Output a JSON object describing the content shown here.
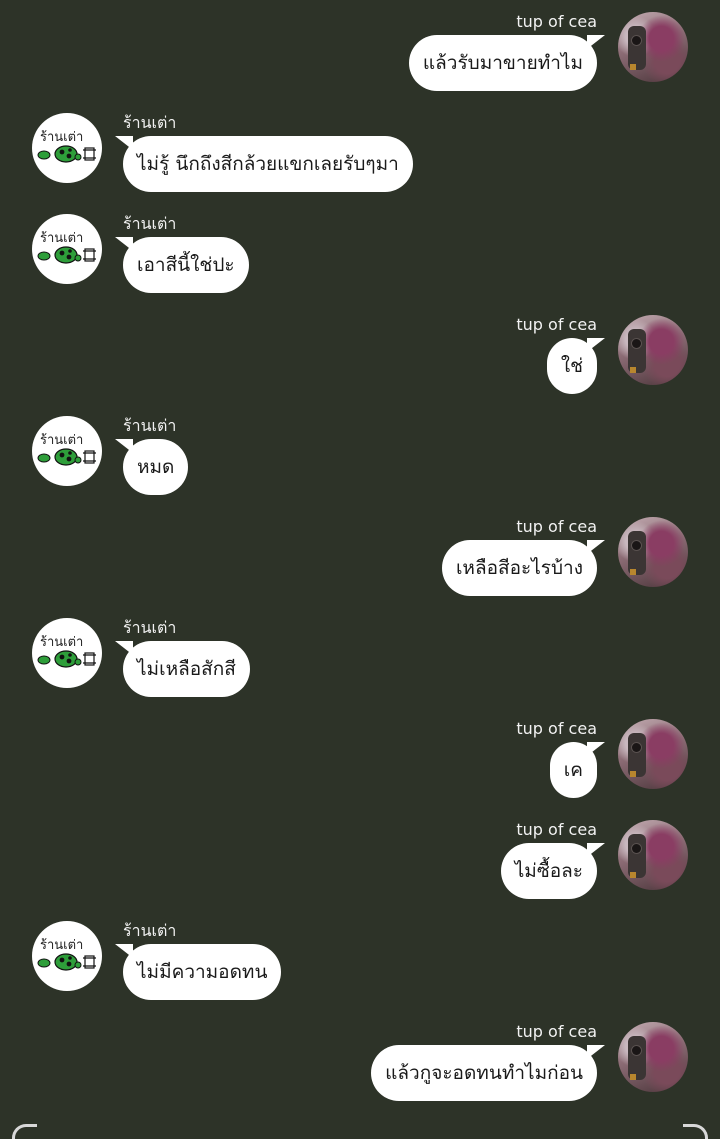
{
  "contacts": {
    "me": "tup of cea",
    "shop": "ร้านเต่า"
  },
  "messages": [
    {
      "sender": "me",
      "name": "tup of cea",
      "text": "แล้วรับมาขายทำไม"
    },
    {
      "sender": "shop",
      "name": "ร้านเต่า",
      "text": "ไม่รู้ นึกถึงสีกล้วยแขกเลยรับๆมา"
    },
    {
      "sender": "shop",
      "name": "ร้านเต่า",
      "text": "เอาสีนี้ใช่ปะ"
    },
    {
      "sender": "me",
      "name": "tup of cea",
      "text": "ใช่"
    },
    {
      "sender": "shop",
      "name": "ร้านเต่า",
      "text": "หมด"
    },
    {
      "sender": "me",
      "name": "tup of cea",
      "text": "เหลือสีอะไรบ้าง"
    },
    {
      "sender": "shop",
      "name": "ร้านเต่า",
      "text": "ไม่เหลือสักสี"
    },
    {
      "sender": "me",
      "name": "tup of cea",
      "text": "เค"
    },
    {
      "sender": "me",
      "name": "tup of cea",
      "text": "ไม่ซื้อละ"
    },
    {
      "sender": "shop",
      "name": "ร้านเต่า",
      "text": "ไม่มีความอดทน"
    },
    {
      "sender": "me",
      "name": "tup of cea",
      "text": "แล้วกูจะอดทนทำไมก่อน"
    }
  ],
  "shop_avatar": {
    "label": "ร้านเต่า",
    "icon": "turtle-logo-icon",
    "accent": "#2e9e3a"
  },
  "colors": {
    "background": "#2d3328",
    "bubble": "#ffffff",
    "name_text": "#f2f2f2"
  }
}
